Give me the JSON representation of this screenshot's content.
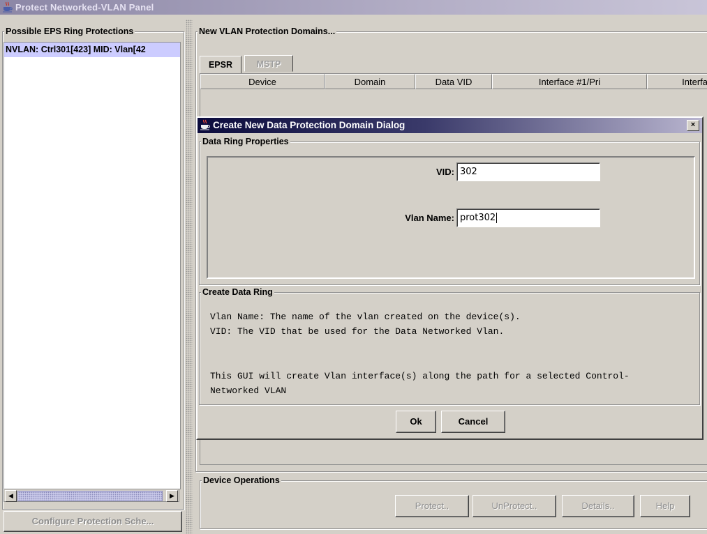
{
  "window": {
    "title": "Protect Networked-VLAN Panel"
  },
  "left_panel": {
    "group_label": "Possible EPS Ring Protections",
    "items": [
      {
        "label": "NVLAN: Ctrl301[423] MID: Vlan[42"
      }
    ],
    "configure_button": "Configure Protection Sche..."
  },
  "right_panel": {
    "group_label": "New VLAN Protection Domains...",
    "tabs": [
      {
        "label": "EPSR",
        "selected": true,
        "enabled": true
      },
      {
        "label": "MSTP",
        "selected": false,
        "enabled": false
      }
    ],
    "table_columns": [
      "Device",
      "Domain",
      "Data VID",
      "Interface #1/Pri",
      "Interfa"
    ],
    "device_operations": {
      "group_label": "Device Operations",
      "buttons": {
        "protect": "Protect..",
        "unprotect": "UnProtect..",
        "details": "Details..",
        "help": "Help"
      }
    }
  },
  "dialog": {
    "title": "Create New Data Protection Domain Dialog",
    "close_label": "×",
    "properties": {
      "group_label": "Data Ring Properties",
      "vid_label": "VID:",
      "vid_value": "302",
      "vlan_name_label": "Vlan Name:",
      "vlan_name_value": "prot302"
    },
    "create_ring": {
      "group_label": "Create Data Ring",
      "line1": "Vlan Name: The name of the vlan created on the device(s).",
      "line2": "VID: The VID that be used for the Data Networked Vlan.",
      "line3": "This GUI will create Vlan interface(s) along the path for a selected Control-",
      "line4": "Networked VLAN"
    },
    "buttons": {
      "ok": "Ok",
      "cancel": "Cancel"
    }
  },
  "colors": {
    "background": "#d4d0c8",
    "selection": "#ccccff",
    "dialog_title_start": "#0b0b3c",
    "dialog_title_end": "#b9b5cf",
    "window_title_start": "#8c87a6"
  },
  "icons": [
    "java-cup-icon",
    "close-icon",
    "scroll-left-icon",
    "scroll-right-icon"
  ]
}
